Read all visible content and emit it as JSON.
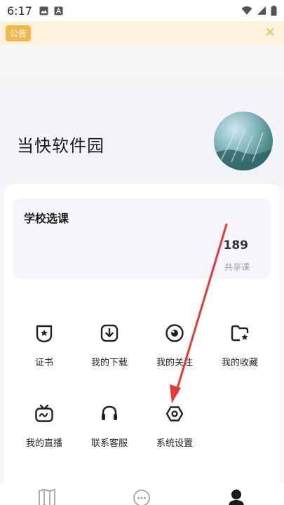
{
  "status_bar": {
    "time": "6:17"
  },
  "notice": {
    "badge": "公告",
    "close_icon": "close-icon"
  },
  "profile": {
    "name": "当快软件园"
  },
  "school_card": {
    "title": "学校选课",
    "shared_count": "189",
    "shared_label": "共享课"
  },
  "menu": [
    {
      "label": "证书",
      "icon": "certificate-icon"
    },
    {
      "label": "我的下载",
      "icon": "download-icon"
    },
    {
      "label": "我的关注",
      "icon": "eye-icon"
    },
    {
      "label": "我的收藏",
      "icon": "folder-star-icon"
    },
    {
      "label": "我的直播",
      "icon": "tv-icon"
    },
    {
      "label": "联系客服",
      "icon": "headset-icon"
    },
    {
      "label": "系统设置",
      "icon": "settings-icon"
    }
  ],
  "tabbar": {
    "icons": [
      "book-icon",
      "chat-icon",
      "profile-icon"
    ]
  },
  "colors": {
    "accent": "#f1b84d",
    "notice_bg": "#fdf3dc",
    "annotation_arrow": "#e53935"
  }
}
